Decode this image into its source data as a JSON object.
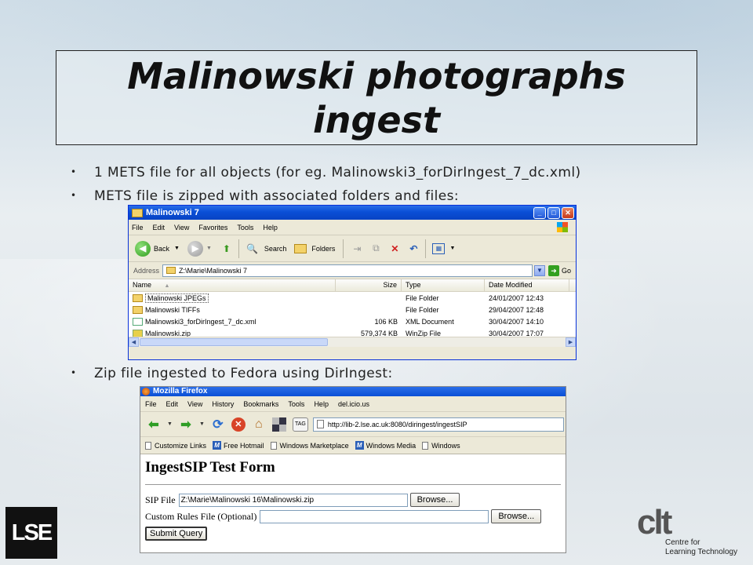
{
  "slide": {
    "title": "Malinowski photographs ingest",
    "bullets": [
      "1 METS file for all objects (for eg. Malinowski3_forDirIngest_7_dc.xml)",
      "METS file is zipped with associated folders and files:",
      "Zip file ingested to Fedora using DirIngest:"
    ]
  },
  "explorer": {
    "title": "Malinowski 7",
    "menu": [
      "File",
      "Edit",
      "View",
      "Favorites",
      "Tools",
      "Help"
    ],
    "toolbar": {
      "back": "Back",
      "search": "Search",
      "folders": "Folders"
    },
    "address_label": "Address",
    "address_value": "Z:\\Marie\\Malinowski 7",
    "go_label": "Go",
    "columns": [
      "Name",
      "Size",
      "Type",
      "Date Modified"
    ],
    "rows": [
      {
        "name": "Malinowski JPEGs",
        "size": "",
        "type": "File Folder",
        "date": "24/01/2007 12:43",
        "icon": "folder-icon"
      },
      {
        "name": "Malinowski TIFFs",
        "size": "",
        "type": "File Folder",
        "date": "29/04/2007 12:48",
        "icon": "folder-icon"
      },
      {
        "name": "Malinowski3_forDirIngest_7_dc.xml",
        "size": "106 KB",
        "type": "XML Document",
        "date": "30/04/2007 14:10",
        "icon": "xml-file-icon"
      },
      {
        "name": "Malinowski.zip",
        "size": "579,374 KB",
        "type": "WinZip File",
        "date": "30/04/2007 17:07",
        "icon": "zip-file-icon"
      }
    ]
  },
  "firefox": {
    "title": "Mozilla Firefox",
    "menu": [
      "File",
      "Edit",
      "View",
      "History",
      "Bookmarks",
      "Tools",
      "Help",
      "del.icio.us"
    ],
    "tag_label": "TAG",
    "url": "http://lib-2.lse.ac.uk:8080/diringest/ingestSIP",
    "bookmarks": [
      "Customize Links",
      "Free Hotmail",
      "Windows Marketplace",
      "Windows Media",
      "Windows"
    ],
    "form": {
      "heading": "IngestSIP Test Form",
      "sip_label": "SIP File",
      "sip_value": "Z:\\Marie\\Malinowski 16\\Malinowski.zip",
      "rules_label": "Custom Rules File (Optional)",
      "rules_value": "",
      "browse_label": "Browse...",
      "submit_label": "Submit Query"
    }
  },
  "logos": {
    "lse": "LSE",
    "clt_mark": "clt",
    "clt_line1": "Centre for",
    "clt_line2": "Learning Technology"
  }
}
